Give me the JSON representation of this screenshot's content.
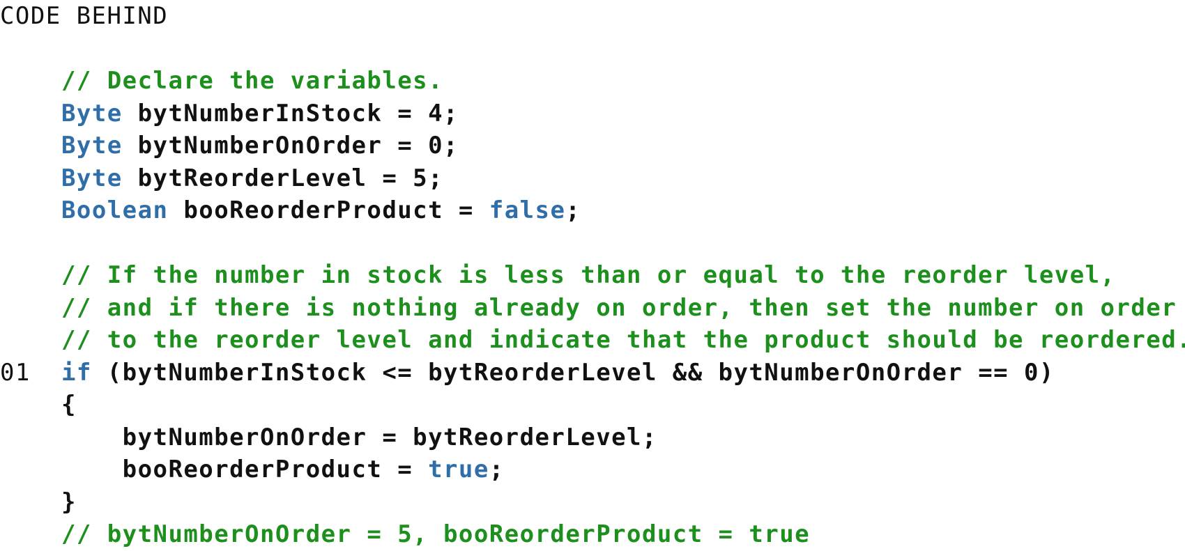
{
  "header": {
    "title": "CODE BEHIND"
  },
  "code": {
    "lines": [
      {
        "number": "",
        "segments": [
          {
            "type": "cm",
            "text": "// Declare the variables."
          }
        ]
      },
      {
        "number": "",
        "segments": [
          {
            "type": "kw",
            "text": "Byte"
          },
          {
            "type": "plain",
            "text": " bytNumberInStock = 4;"
          }
        ]
      },
      {
        "number": "",
        "segments": [
          {
            "type": "kw",
            "text": "Byte"
          },
          {
            "type": "plain",
            "text": " bytNumberOnOrder = 0;"
          }
        ]
      },
      {
        "number": "",
        "segments": [
          {
            "type": "kw",
            "text": "Byte"
          },
          {
            "type": "plain",
            "text": " bytReorderLevel = 5;"
          }
        ]
      },
      {
        "number": "",
        "segments": [
          {
            "type": "kw",
            "text": "Boolean"
          },
          {
            "type": "plain",
            "text": " booReorderProduct = "
          },
          {
            "type": "kw",
            "text": "false"
          },
          {
            "type": "plain",
            "text": ";"
          }
        ]
      },
      {
        "number": "",
        "segments": []
      },
      {
        "number": "",
        "segments": [
          {
            "type": "cm",
            "text": "// If the number in stock is less than or equal to the reorder level,"
          }
        ]
      },
      {
        "number": "",
        "segments": [
          {
            "type": "cm",
            "text": "// and if there is nothing already on order, then set the number on order"
          }
        ]
      },
      {
        "number": "",
        "segments": [
          {
            "type": "cm",
            "text": "// to the reorder level and indicate that the product should be reordered."
          }
        ]
      },
      {
        "number": "01",
        "segments": [
          {
            "type": "kw",
            "text": "if"
          },
          {
            "type": "plain",
            "text": " (bytNumberInStock <= bytReorderLevel && bytNumberOnOrder == 0)"
          }
        ]
      },
      {
        "number": "",
        "segments": [
          {
            "type": "plain",
            "text": "{"
          }
        ]
      },
      {
        "number": "",
        "segments": [
          {
            "type": "plain",
            "text": "    bytNumberOnOrder = bytReorderLevel;"
          }
        ]
      },
      {
        "number": "",
        "segments": [
          {
            "type": "plain",
            "text": "    booReorderProduct = "
          },
          {
            "type": "kw",
            "text": "true"
          },
          {
            "type": "plain",
            "text": ";"
          }
        ]
      },
      {
        "number": "",
        "segments": [
          {
            "type": "plain",
            "text": "}"
          }
        ]
      },
      {
        "number": "",
        "segments": [
          {
            "type": "cm",
            "text": "// bytNumberOnOrder = 5, booReorderProduct = true"
          }
        ]
      }
    ]
  },
  "colors": {
    "keyword": "#2f6ea8",
    "comment": "#1d8f1d",
    "text": "#111111",
    "background": "#ffffff"
  }
}
